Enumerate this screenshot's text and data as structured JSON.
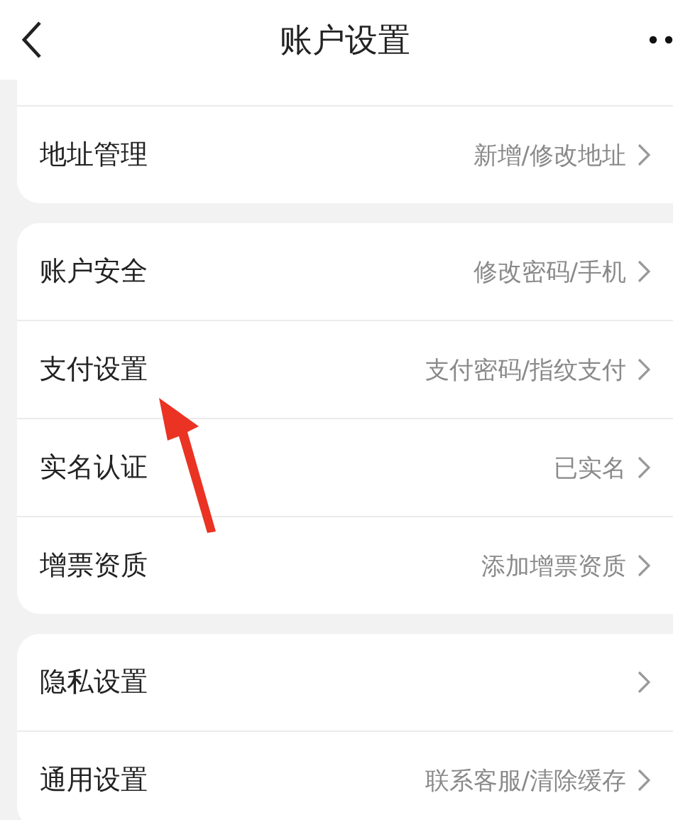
{
  "header": {
    "title": "账户设置"
  },
  "groups": [
    {
      "rows": [
        {
          "label": "地址管理",
          "value": "新增/修改地址"
        }
      ]
    },
    {
      "rows": [
        {
          "label": "账户安全",
          "value": "修改密码/手机"
        },
        {
          "label": "支付设置",
          "value": "支付密码/指纹支付"
        },
        {
          "label": "实名认证",
          "value": "已实名"
        },
        {
          "label": "增票资质",
          "value": "添加增票资质"
        }
      ]
    },
    {
      "rows": [
        {
          "label": "隐私设置"
        },
        {
          "label": "通用设置",
          "value": "联系客服/清除缓存"
        }
      ]
    }
  ],
  "annotation": {
    "kind": "arrow"
  }
}
